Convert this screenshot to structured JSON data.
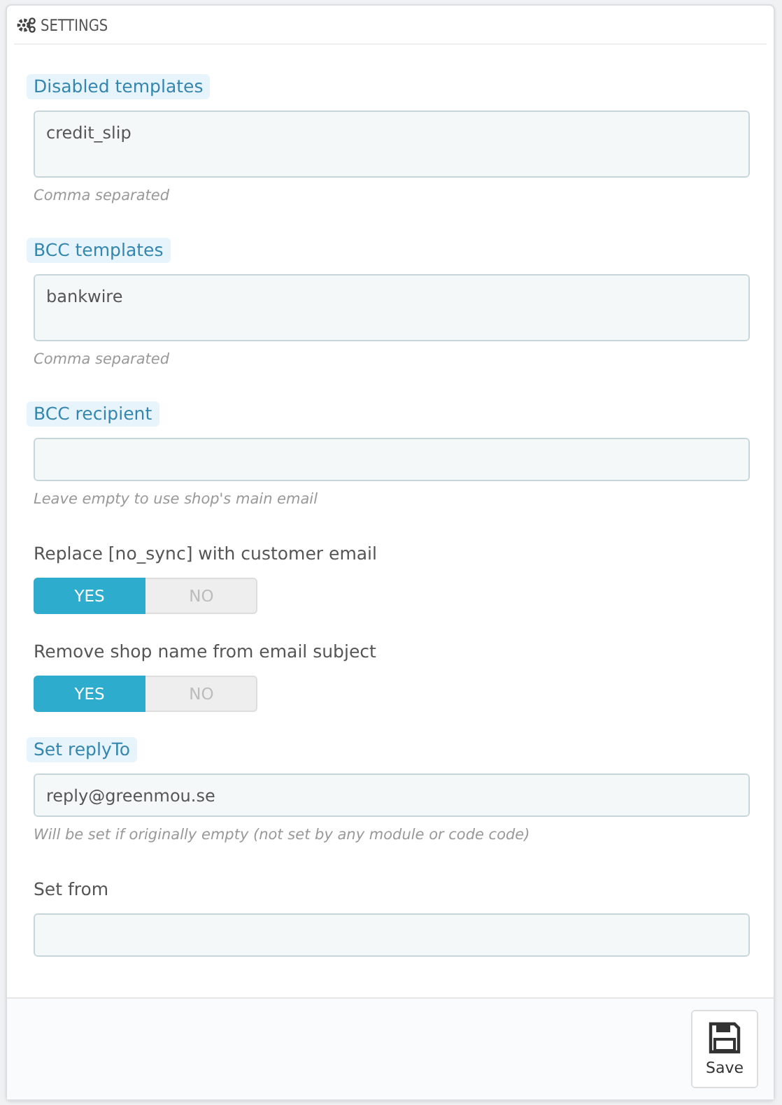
{
  "panel": {
    "title": "SETTINGS"
  },
  "fields": [
    {
      "kind": "textarea",
      "label": "Disabled templates",
      "highlighted": true,
      "value": "credit_slip",
      "hint": "Comma separated"
    },
    {
      "kind": "textarea",
      "label": "BCC templates",
      "highlighted": true,
      "value": "bankwire",
      "hint": "Comma separated"
    },
    {
      "kind": "text",
      "label": "BCC recipient",
      "highlighted": true,
      "hint": "Leave empty to use shop's main email"
    },
    {
      "kind": "switch",
      "label": "Replace [no_sync] with customer email",
      "highlighted": false,
      "yes": "YES",
      "no": "NO",
      "on": true
    },
    {
      "kind": "switch",
      "label": "Remove shop name from email subject",
      "highlighted": false,
      "yes": "YES",
      "no": "NO",
      "on": true
    },
    {
      "kind": "text",
      "label": "Set replyTo",
      "highlighted": true,
      "value": "reply@greenmou.se",
      "hint": "Will be set if originally empty (not set by any module or code code)"
    },
    {
      "kind": "text",
      "label": "Set from",
      "highlighted": false
    }
  ],
  "save_button": {
    "label": "Save"
  }
}
